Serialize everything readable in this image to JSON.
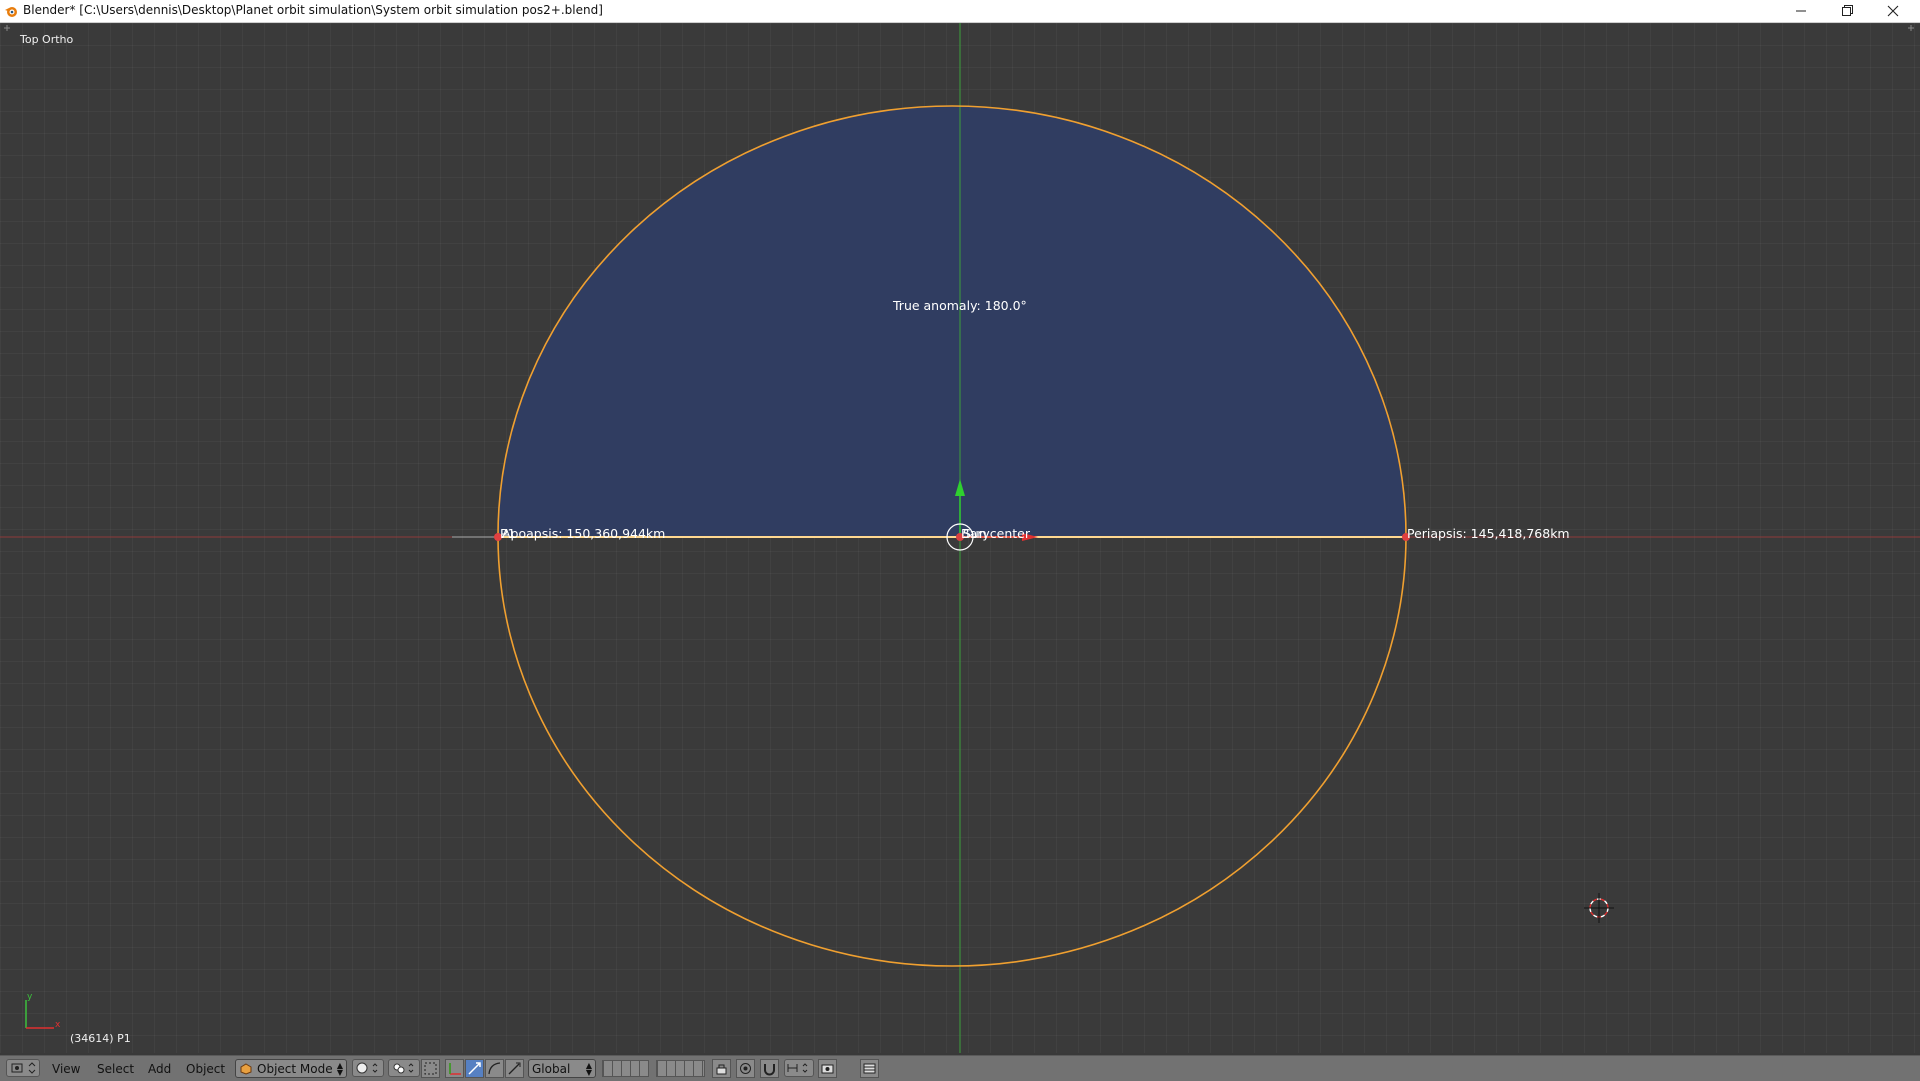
{
  "window": {
    "title": "Blender* [C:\\Users\\dennis\\Desktop\\Planet orbit simulation\\System orbit simulation pos2+.blend]",
    "app_icon": "blender-icon",
    "controls": [
      "minimize-icon",
      "restore-icon",
      "close-icon"
    ]
  },
  "viewport": {
    "view_name": "Top Ortho",
    "labels": {
      "true_anomaly": "True anomaly: 180.0°",
      "apoapsis_tag": "P1",
      "apoapsis": "Apoapsis: 150,360,944km",
      "barycenter_tag": "Sun",
      "barycenter": "Barycenter",
      "periapsis": "Periapsis: 145,418,768km"
    },
    "object_info": "(34614) P1",
    "axis": {
      "y": "y",
      "x": "x"
    },
    "colors": {
      "background": "#393939",
      "orbit": "#f0a030",
      "swept_area": "#2f3d63",
      "x_axis": "#b33c3c",
      "y_axis": "#3cb43c",
      "selected_line": "#ffd890"
    }
  },
  "header": {
    "editor_icon": "3d-view-icon",
    "menus": [
      "View",
      "Select",
      "Add",
      "Object"
    ],
    "mode": "Object Mode",
    "orientation": "Global"
  }
}
